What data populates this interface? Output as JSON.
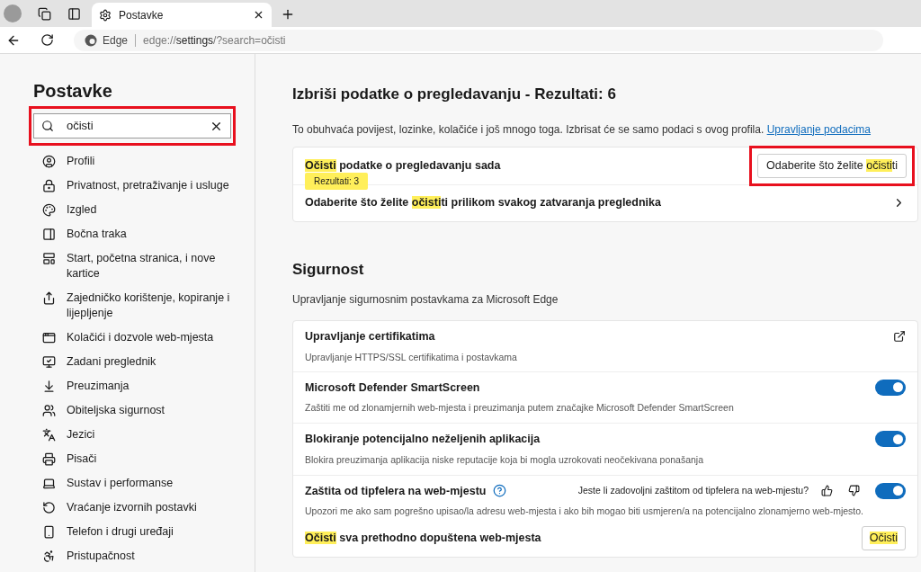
{
  "browser": {
    "tab": {
      "title": "Postavke",
      "selected": true
    },
    "address": {
      "site": "Edge",
      "url_start": "edge://",
      "url_mid": "settings",
      "url_end": "/?search=očisti"
    }
  },
  "sidebar": {
    "title": "Postavke",
    "search": {
      "value": "očisti",
      "annotated": true
    },
    "items": [
      {
        "label": "Profili"
      },
      {
        "label": "Privatnost, pretraživanje i usluge"
      },
      {
        "label": "Izgled"
      },
      {
        "label": "Bočna traka"
      },
      {
        "label": "Start, početna stranica, i nove kartice"
      },
      {
        "label": "Zajedničko korištenje, kopiranje i lijepljenje"
      },
      {
        "label": "Kolačići i dozvole web-mjesta"
      },
      {
        "label": "Zadani preglednik"
      },
      {
        "label": "Preuzimanja"
      },
      {
        "label": "Obiteljska sigurnost"
      },
      {
        "label": "Jezici"
      },
      {
        "label": "Pisači"
      },
      {
        "label": "Sustav i performanse"
      },
      {
        "label": "Vraćanje izvornih postavki"
      },
      {
        "label": "Telefon i drugi uređaji"
      },
      {
        "label": "Pristupačnost"
      }
    ]
  },
  "clear_section": {
    "title": "Izbriši podatke o pregledavanju - Rezultati: 6",
    "description": "To obuhvaća povijest, lozinke, kolačiće i još mnogo toga. Izbrisat će se samo podaci s ovog profila.",
    "link": "Upravljanje podacima",
    "rows": [
      {
        "kind": "button",
        "label": [
          {
            "text": "Očisti",
            "highlight": true
          },
          {
            "text": " podatke o pregledavanju sada",
            "highlight": false
          }
        ],
        "badge": "Rezultati: 3",
        "button": {
          "parts": [
            {
              "text": "Odaberite što želite ",
              "highlight": false
            },
            {
              "text": "očisti",
              "highlight": true
            },
            {
              "text": "ti",
              "highlight": false
            }
          ],
          "annotated": true
        }
      },
      {
        "kind": "chevron",
        "label": [
          {
            "text": "Odaberite što želite ",
            "highlight": false
          },
          {
            "text": "očisti",
            "highlight": true
          },
          {
            "text": "ti prilikom svakog zatvaranja preglednika",
            "highlight": false
          }
        ]
      }
    ]
  },
  "security": {
    "title": "Sigurnost",
    "subtitle": "Upravljanje sigurnosnim postavkama za Microsoft Edge",
    "rows": [
      {
        "kind": "external",
        "title": "Upravljanje certifikatima",
        "description": "Upravljanje HTTPS/SSL certifikatima i postavkama"
      },
      {
        "kind": "toggle",
        "title": "Microsoft Defender SmartScreen",
        "description": "Zaštiti me od zlonamjernih web-mjesta i preuzimanja putem značajke Microsoft Defender SmartScreen",
        "on": true
      },
      {
        "kind": "toggle",
        "title": "Blokiranje potencijalno neželjenih aplikacija",
        "description": "Blokira preuzimanja aplikacija niske reputacije koja bi mogla uzrokovati neočekivana ponašanja",
        "on": true
      },
      {
        "kind": "feedback_toggle",
        "title": "Zaštita od tipfelera na web-mjestu",
        "feedback": "Jeste li zadovoljni zaštitom od tipfelera na web-mjestu?",
        "description": "Upozori me ako sam pogrešno upisao/la adresu web-mjesta i ako bih mogao biti usmjeren/a na potencijalno zlonamjerno web-mjesto.",
        "on": true,
        "action": {
          "label": [
            {
              "text": "Očisti",
              "highlight": true
            },
            {
              "text": " sva prethodno dopuštena web-mjesta",
              "highlight": false
            }
          ],
          "button": {
            "parts": [
              {
                "text": "Očisti",
                "highlight": true
              }
            ]
          }
        }
      }
    ]
  }
}
